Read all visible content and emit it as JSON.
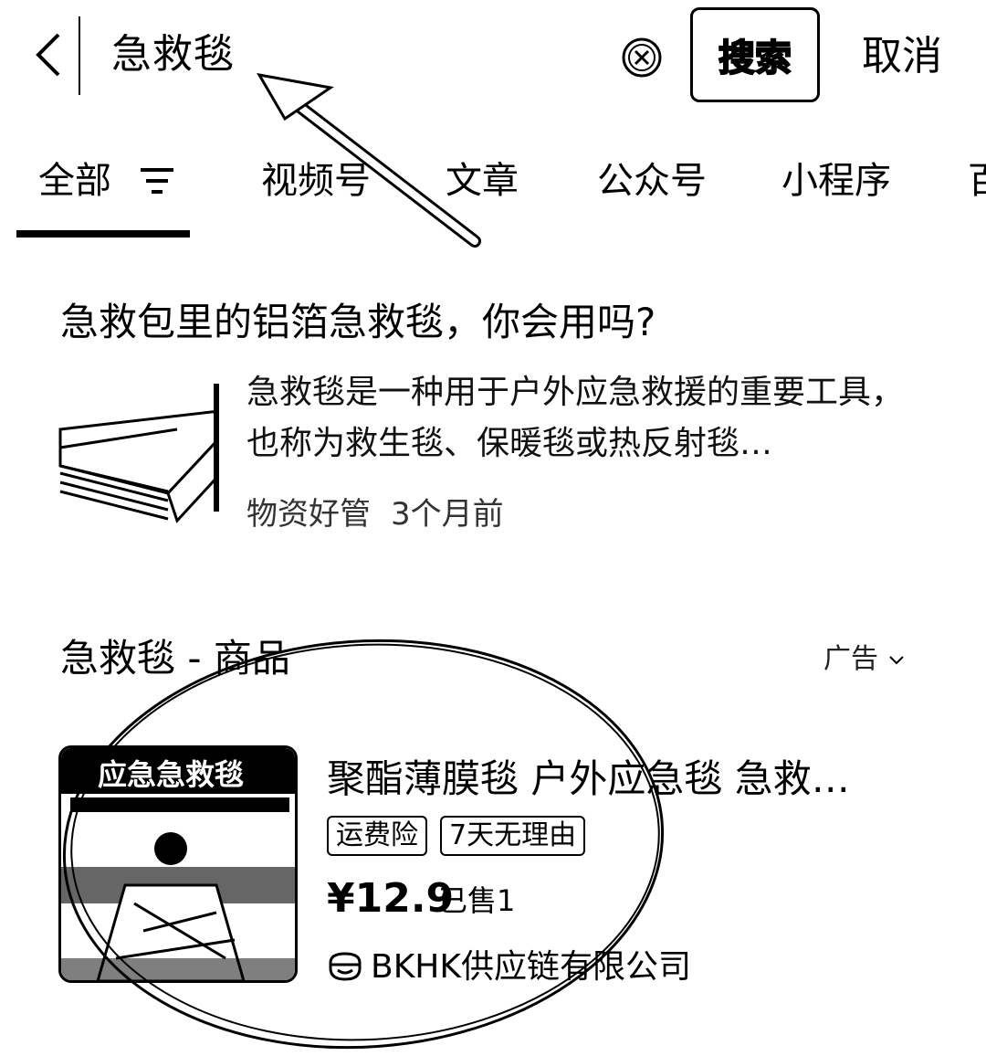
{
  "search": {
    "query": "急救毯",
    "button_label": "搜索",
    "cancel_label": "取消"
  },
  "tabs": [
    {
      "label": "全部",
      "active": true
    },
    {
      "label": "视频号"
    },
    {
      "label": "文章"
    },
    {
      "label": "公众号"
    },
    {
      "label": "小程序"
    },
    {
      "label": "百"
    }
  ],
  "article": {
    "title": "急救包里的铝箔急救毯，你会用吗?",
    "snippet": "急救毯是一种用于户外应急救援的重要工具，也称为救生毯、保暖毯或热反射毯…",
    "source": "物资好管",
    "time": "3个月前"
  },
  "products": {
    "section_title": "急救毯 - 商品",
    "ad_label": "广告",
    "item": {
      "image_text": "应急急救毯",
      "title": "聚酯薄膜毯 户外应急毯 急救…",
      "tags": [
        "运费险",
        "7天无理由"
      ],
      "price": "¥12.9",
      "sold": "已售1",
      "shop": "BKHK供应链有限公司"
    }
  },
  "icons": {
    "back": "chevron-left-icon",
    "clear": "clear-circle-icon",
    "filter": "filter-icon",
    "ad_toggle": "chevron-down-icon",
    "shop": "shop-icon"
  }
}
